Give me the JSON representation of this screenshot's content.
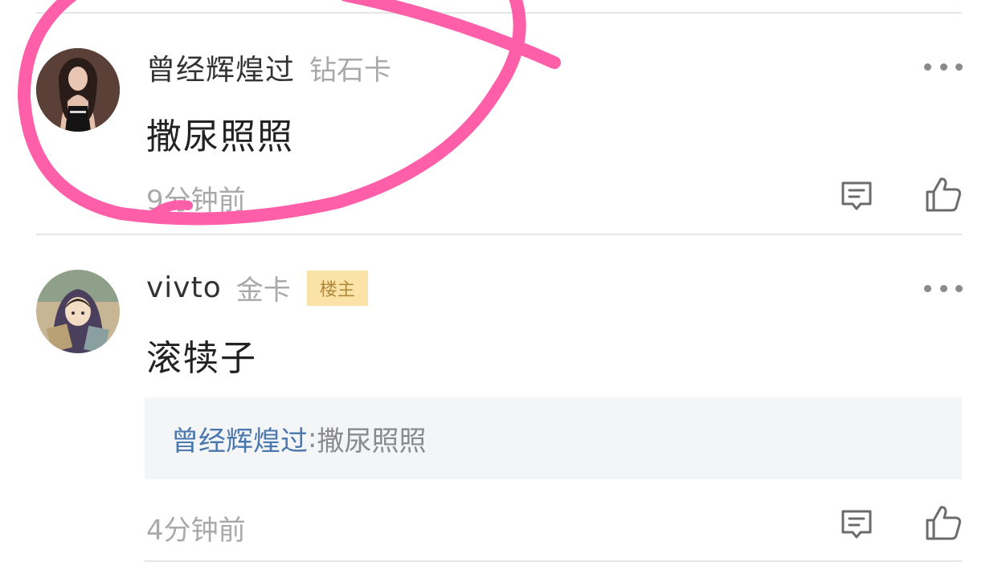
{
  "comments": [
    {
      "username": "曾经辉煌过",
      "level": "钻石卡",
      "content": "撒尿照照",
      "time": "9分钟前"
    },
    {
      "username": "vivto",
      "level": "金卡",
      "badge": "楼主",
      "content": "滚犊子",
      "quote": {
        "author": "曾经辉煌过",
        "separator": ":",
        "text": "撒尿照照"
      },
      "time": "4分钟前"
    }
  ],
  "icons": {
    "more": "more-dots-icon",
    "reply": "reply-bubble-icon",
    "like": "thumbs-up-icon"
  },
  "colors": {
    "annotation": "#ff5fa8",
    "quote_author": "#4a78ae",
    "badge_bg": "#fbe2a6",
    "badge_text": "#b08a3a"
  }
}
